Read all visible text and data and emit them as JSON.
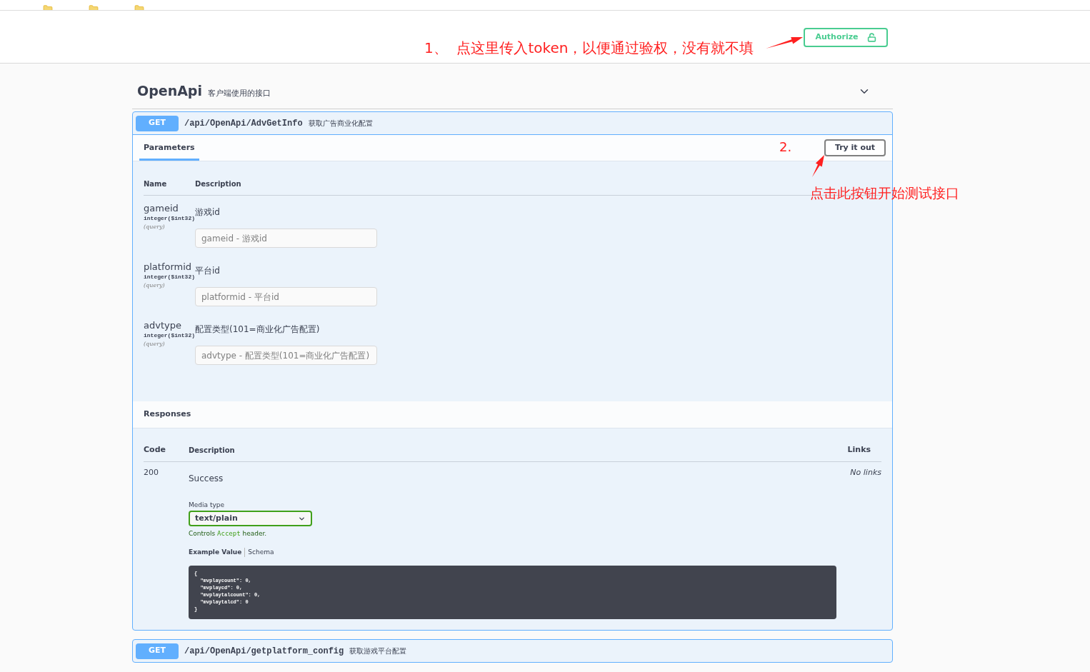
{
  "annotations": [
    {
      "text": "1、  点这里传入token，以便通过验权，没有就不填"
    },
    {
      "text": "2."
    },
    {
      "text": "点击此按钮开始测试接口"
    }
  ],
  "authorize_button": {
    "label": "Authorize"
  },
  "section": {
    "title": "OpenApi",
    "description": "客户端使用的接口",
    "expanded": true
  },
  "operations": [
    {
      "method": "GET",
      "path": "/api/OpenApi/AdvGetInfo",
      "summary": "获取广告商业化配置",
      "expanded": true
    },
    {
      "method": "GET",
      "path": "/api/OpenApi/getplatform_config",
      "summary": "获取游戏平台配置",
      "expanded": false
    }
  ],
  "parameters_tab": {
    "label": "Parameters",
    "selected": true
  },
  "try_button": {
    "label": "Try it out"
  },
  "param_columns": [
    "Name",
    "Description"
  ],
  "parameters": [
    {
      "name": "gameid",
      "type": "integer",
      "format": "($int32)",
      "location": "(query)",
      "description": "游戏id",
      "placeholder": "gameid - 游戏id"
    },
    {
      "name": "platformid",
      "type": "integer",
      "format": "($int32)",
      "location": "(query)",
      "description": "平台id",
      "placeholder": "platformid - 平台id"
    },
    {
      "name": "advtype",
      "type": "integer",
      "format": "($int32)",
      "location": "(query)",
      "description": "配置类型(101=商业化广告配置)",
      "placeholder": "advtype - 配置类型(101=商业化广告配置)"
    }
  ],
  "responses": {
    "title": "Responses",
    "columns": [
      "Code",
      "Description",
      "Links"
    ],
    "rows": [
      {
        "code": "200",
        "description": "Success",
        "links": "No links",
        "media_type_label": "Media type",
        "media_type": "text/plain",
        "controls_note": [
          "Controls ",
          "Accept",
          " header."
        ],
        "example_tabs": [
          {
            "label": "Example Value",
            "selected": true
          },
          {
            "label": "Schema",
            "selected": false
          }
        ],
        "example_lines": [
          "{",
          "  \"mvplaycount\": 0,",
          "  \"mvplaycd\": 0,",
          "  \"mvplaytalcount\": 0,",
          "  \"mvplaytalcd\": 0",
          "}"
        ]
      }
    ]
  }
}
